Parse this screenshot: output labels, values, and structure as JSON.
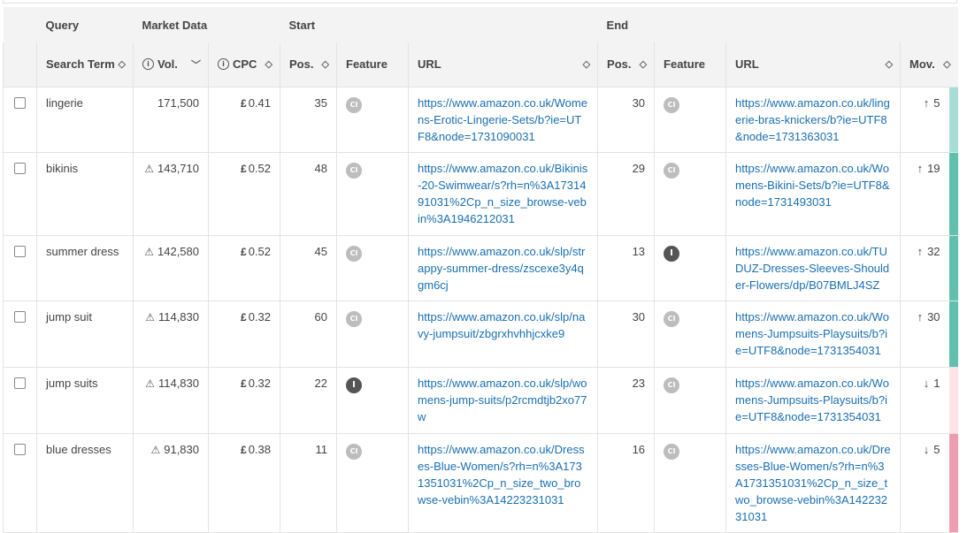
{
  "groups": {
    "query": "Query",
    "market": "Market Data",
    "start": "Start",
    "end": "End"
  },
  "headers": {
    "search_term": "Search Term",
    "vol": "Vol.",
    "cpc": "CPC",
    "start_pos": "Pos.",
    "start_feature": "Feature",
    "start_url": "URL",
    "end_pos": "Pos.",
    "end_feature": "Feature",
    "end_url": "URL",
    "mov": "Mov."
  },
  "icons": {
    "sort": "sort-diamond-icon",
    "sort_desc": "chevron-down-icon",
    "info": "info-icon",
    "warning": "warning-triangle-icon"
  },
  "colors": {
    "up": "#2aa58e",
    "down": "#d0344c",
    "link": "#1a6fb0"
  },
  "rows": [
    {
      "term": "lingerie",
      "warn": false,
      "vol": "171,500",
      "cpc": "0.41",
      "start_pos": "35",
      "start_feat": "CI",
      "start_url": "https://www.amazon.co.uk/Womens-Erotic-Lingerie-Sets/b?ie=UTF8&node=1731090031",
      "end_pos": "30",
      "end_feat": "CI",
      "end_url": "https://www.amazon.co.uk/lingerie-bras-knickers/b?ie=UTF8&node=1731363031",
      "dir": "up",
      "arrow": "↑",
      "mov": "5",
      "bar": "#a8ddd5"
    },
    {
      "term": "bikinis",
      "warn": true,
      "vol": "143,710",
      "cpc": "0.52",
      "start_pos": "48",
      "start_feat": "CI",
      "start_url": "https://www.amazon.co.uk/Bikinis-20-Swimwear/s?rh=n%3A1731491031%2Cp_n_size_browse-vebin%3A1946212031",
      "end_pos": "29",
      "end_feat": "CI",
      "end_url": "https://www.amazon.co.uk/Womens-Bikini-Sets/b?ie=UTF8&node=1731493031",
      "dir": "up",
      "arrow": "↑",
      "mov": "19",
      "bar": "#5ec0ad"
    },
    {
      "term": "summer dress",
      "warn": true,
      "vol": "142,580",
      "cpc": "0.52",
      "start_pos": "45",
      "start_feat": "CI",
      "start_url": "https://www.amazon.co.uk/slp/strappy-summer-dress/zscexe3y4qgm6cj",
      "end_pos": "13",
      "end_feat": "I",
      "end_url": "https://www.amazon.co.uk/TUDUZ-Dresses-Sleeves-Shoulder-Flowers/dp/B07BMLJ4SZ",
      "dir": "up",
      "arrow": "↑",
      "mov": "32",
      "bar": "#5ec0ad"
    },
    {
      "term": "jump suit",
      "warn": true,
      "vol": "114,830",
      "cpc": "0.32",
      "start_pos": "60",
      "start_feat": "CI",
      "start_url": "https://www.amazon.co.uk/slp/navy-jumpsuit/zbgrxhvhhjcxke9",
      "end_pos": "30",
      "end_feat": "CI",
      "end_url": "https://www.amazon.co.uk/Womens-Jumpsuits-Playsuits/b?ie=UTF8&node=1731354031",
      "dir": "up",
      "arrow": "↑",
      "mov": "30",
      "bar": "#5ec0ad"
    },
    {
      "term": "jump suits",
      "warn": true,
      "vol": "114,830",
      "cpc": "0.32",
      "start_pos": "22",
      "start_feat": "I",
      "start_url": "https://www.amazon.co.uk/slp/womens-jump-suits/p2rcmdtjb2xo77w",
      "end_pos": "23",
      "end_feat": "CI",
      "end_url": "https://www.amazon.co.uk/Womens-Jumpsuits-Playsuits/b?ie=UTF8&node=1731354031",
      "dir": "down",
      "arrow": "↓",
      "mov": "1",
      "bar": "#fbe3e8"
    },
    {
      "term": "blue dresses",
      "warn": true,
      "vol": "91,830",
      "cpc": "0.38",
      "start_pos": "11",
      "start_feat": "CI",
      "start_url": "https://www.amazon.co.uk/Dresses-Blue-Women/s?rh=n%3A1731351031%2Cp_n_size_two_browse-vebin%3A14223231031",
      "end_pos": "16",
      "end_feat": "CI",
      "end_url": "https://www.amazon.co.uk/Dresses-Blue-Women/s?rh=n%3A1731351031%2Cp_n_size_two_browse-vebin%3A14223231031",
      "dir": "down",
      "arrow": "↓",
      "mov": "5",
      "bar": "#ee9db0"
    }
  ]
}
